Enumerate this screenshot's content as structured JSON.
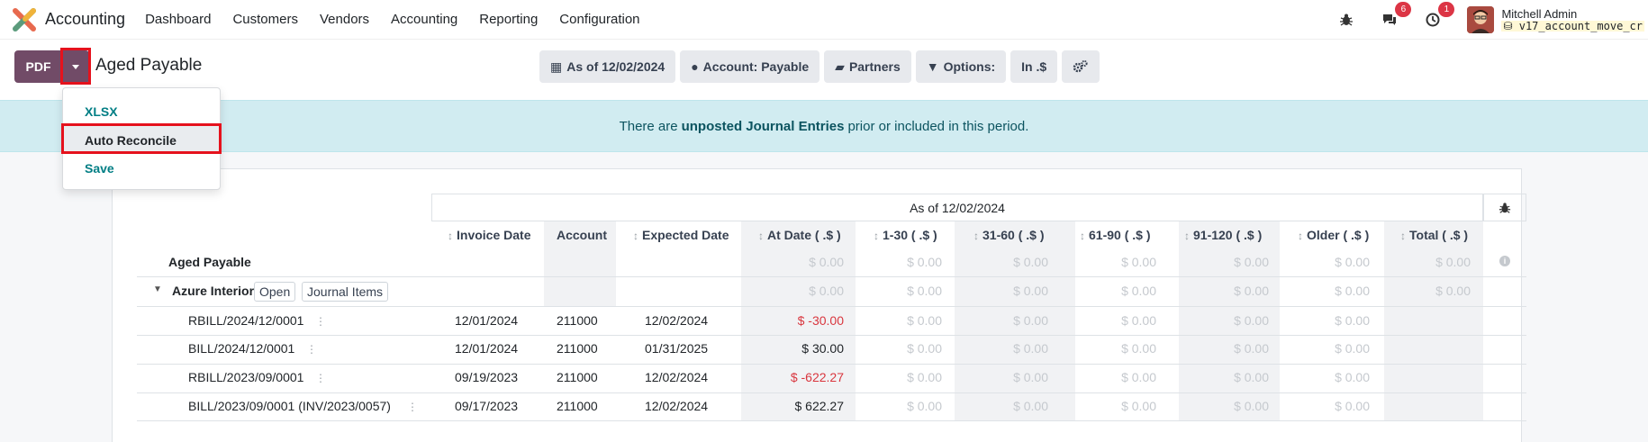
{
  "navbar": {
    "app_name": "Accounting",
    "menu": [
      "Dashboard",
      "Customers",
      "Vendors",
      "Accounting",
      "Reporting",
      "Configuration"
    ],
    "messages_count": "6",
    "activities_count": "1",
    "user_name": "Mitchell Admin",
    "database": "v17_account_move_cr"
  },
  "toolbar": {
    "pdf_label": "PDF",
    "report_title": "Aged Payable",
    "filters": [
      {
        "icon": "calendar-icon",
        "glyph": "▦",
        "label": "As of 12/02/2024"
      },
      {
        "icon": "user-icon",
        "glyph": "●",
        "label": "Account: Payable"
      },
      {
        "icon": "folder-open-icon",
        "glyph": "▰",
        "label": "Partners"
      },
      {
        "icon": "filter-icon",
        "glyph": "▼",
        "label": "Options:"
      },
      {
        "icon": "",
        "glyph": "",
        "label": "In .$"
      }
    ]
  },
  "dropdown": {
    "items": [
      "XLSX",
      "Auto Reconcile",
      "Save"
    ],
    "active": "Auto Reconcile"
  },
  "alert": {
    "prefix": "There are",
    "strong": "unposted Journal Entries",
    "suffix": "prior or included in this period."
  },
  "report": {
    "period_header": "As of 12/02/2024",
    "columns": [
      "Invoice Date",
      "Account",
      "Expected Date",
      "At Date ( .$ )",
      "1-30 ( .$ )",
      "31-60 ( .$ )",
      "61-90 ( .$ )",
      "91-120 ( .$ )",
      "Older ( .$ )",
      "Total ( .$ )"
    ],
    "total_row": {
      "label": "Aged Payable",
      "values": [
        "$ 0.00",
        "$ 0.00",
        "$ 0.00",
        "$ 0.00",
        "$ 0.00",
        "$ 0.00",
        "$ 0.00"
      ]
    },
    "partner_row": {
      "label": "Azure Interior",
      "open_label": "Open",
      "journal_label": "Journal Items",
      "values": [
        "$ 0.00",
        "$ 0.00",
        "$ 0.00",
        "$ 0.00",
        "$ 0.00",
        "$ 0.00",
        "$ 0.00"
      ]
    },
    "lines": [
      {
        "name": "RBILL/2024/12/0001",
        "invoice_date": "12/01/2024",
        "account": "211000",
        "expected_date": "12/02/2024",
        "at_date": "$ -30.00",
        "negative": true,
        "buckets": [
          "$ 0.00",
          "$ 0.00",
          "$ 0.00",
          "$ 0.00",
          "$ 0.00"
        ]
      },
      {
        "name": "BILL/2024/12/0001",
        "invoice_date": "12/01/2024",
        "account": "211000",
        "expected_date": "01/31/2025",
        "at_date": "$ 30.00",
        "negative": false,
        "buckets": [
          "$ 0.00",
          "$ 0.00",
          "$ 0.00",
          "$ 0.00",
          "$ 0.00"
        ]
      },
      {
        "name": "RBILL/2023/09/0001",
        "invoice_date": "09/19/2023",
        "account": "211000",
        "expected_date": "12/02/2024",
        "at_date": "$ -622.27",
        "negative": true,
        "buckets": [
          "$ 0.00",
          "$ 0.00",
          "$ 0.00",
          "$ 0.00",
          "$ 0.00"
        ]
      },
      {
        "name": "BILL/2023/09/0001 (INV/2023/0057)",
        "invoice_date": "09/17/2023",
        "account": "211000",
        "expected_date": "12/02/2024",
        "at_date": "$ 622.27",
        "negative": false,
        "buckets": [
          "$ 0.00",
          "$ 0.00",
          "$ 0.00",
          "$ 0.00",
          "$ 0.00"
        ]
      }
    ]
  }
}
